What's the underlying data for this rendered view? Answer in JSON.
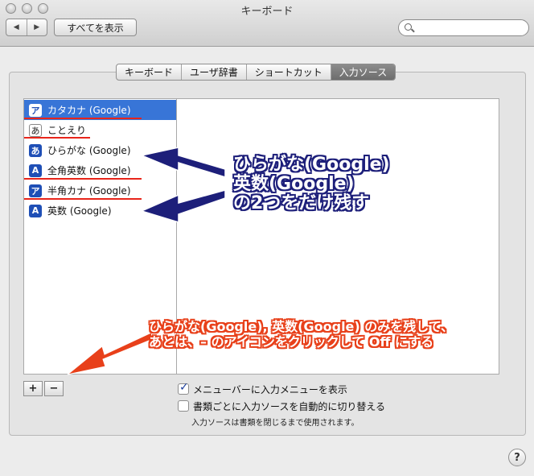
{
  "window": {
    "title": "キーボード"
  },
  "toolbar": {
    "back_glyph": "◀",
    "forward_glyph": "▶",
    "show_all_label": "すべてを表示",
    "search_placeholder": ""
  },
  "tabs": [
    {
      "label": "キーボード",
      "active": false
    },
    {
      "label": "ユーザ辞書",
      "active": false
    },
    {
      "label": "ショートカット",
      "active": false
    },
    {
      "label": "入力ソース",
      "active": true
    }
  ],
  "input_sources": [
    {
      "icon": "ア",
      "icon_style": "blue",
      "label": "カタカナ (Google)",
      "selected": true
    },
    {
      "icon": "あ",
      "icon_style": "white",
      "label": "ことえり",
      "selected": false
    },
    {
      "icon": "あ",
      "icon_style": "blue",
      "label": "ひらがな (Google)",
      "selected": false
    },
    {
      "icon": "A",
      "icon_style": "blue",
      "label": "全角英数 (Google)",
      "selected": false
    },
    {
      "icon": "ア",
      "icon_style": "blue",
      "label": "半角カナ (Google)",
      "selected": false
    },
    {
      "icon": "A",
      "icon_style": "blue",
      "label": "英数 (Google)",
      "selected": false
    }
  ],
  "buttons": {
    "add": "+",
    "remove": "−",
    "help": "?"
  },
  "options": {
    "show_menu": {
      "label": "メニューバーに入力メニューを表示",
      "checked": true
    },
    "per_document": {
      "label": "書類ごとに入力ソースを自動的に切り替える",
      "checked": false
    },
    "note": "入力ソースは書類を閉じるまで使用されます。"
  },
  "annotations": {
    "keep_lines": [
      "ひらがな(Google)",
      "英数(Google)",
      "の2つをだけ残す"
    ],
    "instruction_lines": [
      "ひらがな(Google), 英数(Google) のみを残して、",
      "あとは、– のアイコンをクリックして Off にする"
    ],
    "colors": {
      "navy": "#1d1f7a",
      "red": "#e8401a",
      "underline": "#e8251a"
    }
  }
}
